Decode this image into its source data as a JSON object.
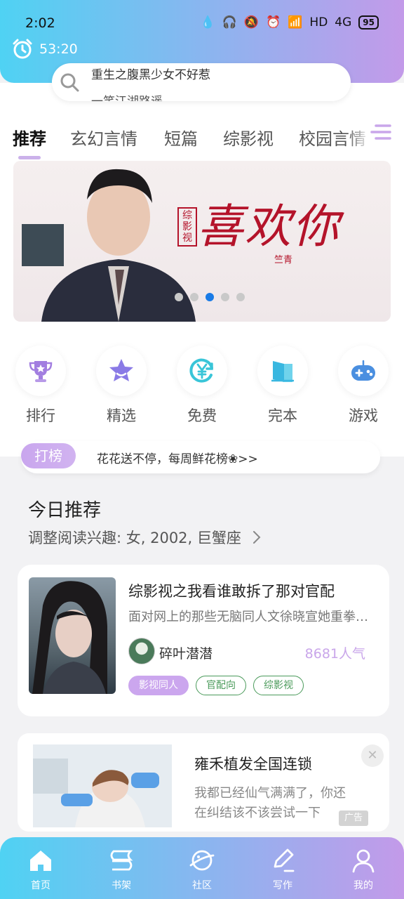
{
  "status_bar": {
    "time": "2:02",
    "network": "HD",
    "signal": "4G",
    "battery": "95"
  },
  "timer": {
    "value": "53:20"
  },
  "search": {
    "hint_line1": "重生之腹黑少女不好惹",
    "hint_line2": "一笑江湖路遥"
  },
  "tabs": [
    "推荐",
    "玄幻言情",
    "短篇",
    "综影视",
    "校园言情"
  ],
  "banner": {
    "title": "喜欢你",
    "tag": "综影视",
    "author": "竺青",
    "dot_count": 5,
    "active_dot": 2
  },
  "quick_entries": [
    {
      "label": "排行",
      "icon": "trophy-icon"
    },
    {
      "label": "精选",
      "icon": "star-icon"
    },
    {
      "label": "免费",
      "icon": "free-yen-icon"
    },
    {
      "label": "完本",
      "icon": "book-icon"
    },
    {
      "label": "游戏",
      "icon": "gamepad-icon"
    }
  ],
  "rank_bar": {
    "tag": "打榜",
    "text": "花花送不停，每周鲜花榜❀>>"
  },
  "today": {
    "title": "今日推荐",
    "subtitle": "调整阅读兴趣: 女, 2002, 巨蟹座"
  },
  "book": {
    "title": "综影视之我看谁敢拆了那对官配",
    "desc": "面对网上的那些无脑同人文徐晓宣她重拳出击",
    "author": "碎叶潜潜",
    "popularity": "8681人气",
    "tags": [
      "影视同人",
      "官配向",
      "综影视"
    ]
  },
  "ad": {
    "title": "雍禾植发全国连锁",
    "desc": "我都已经仙气满满了，你还在纠结该不该尝试一下",
    "badge": "广告"
  },
  "bottom_nav": [
    {
      "label": "首页",
      "icon": "home-icon"
    },
    {
      "label": "书架",
      "icon": "bookshelf-icon"
    },
    {
      "label": "社区",
      "icon": "planet-icon"
    },
    {
      "label": "写作",
      "icon": "pen-icon"
    },
    {
      "label": "我的",
      "icon": "profile-icon"
    }
  ],
  "colors": {
    "accent_purple": "#cba6ee",
    "gradient_start": "#4fd2f3",
    "gradient_end": "#c39ae9",
    "active_dot": "#1a7be6",
    "tag_green": "#4a9a5a"
  }
}
